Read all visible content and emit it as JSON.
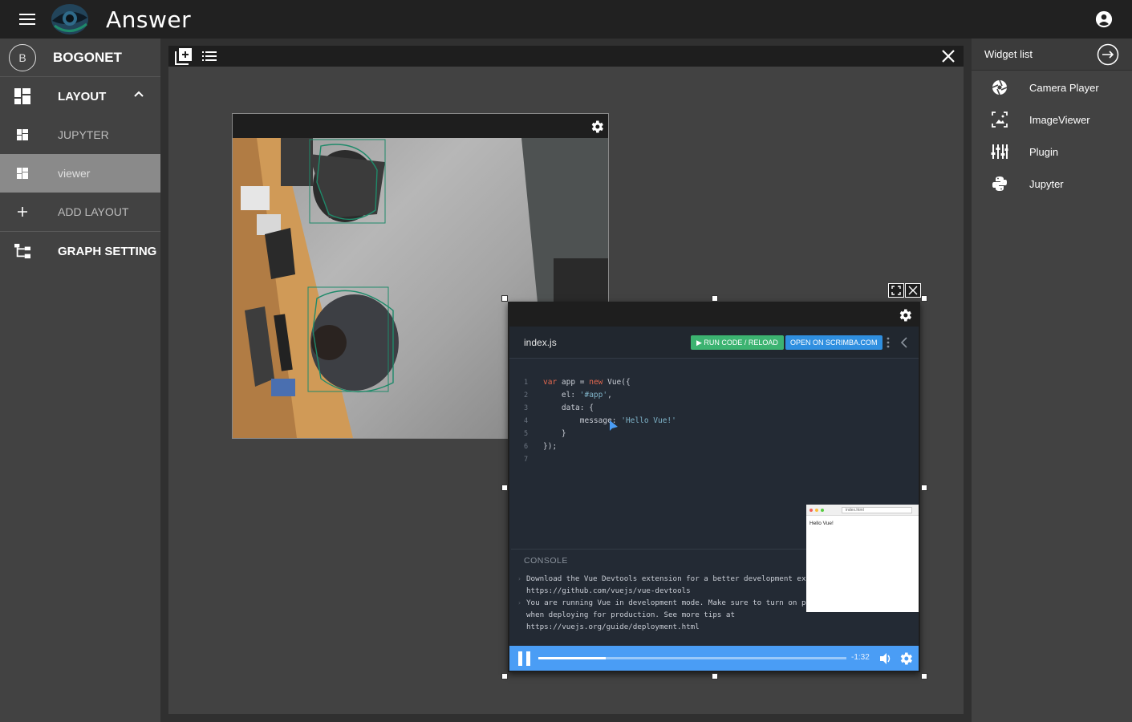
{
  "app": {
    "title": "Answer"
  },
  "sidebar": {
    "profile": {
      "initial": "B",
      "name": "BOGONET"
    },
    "items": [
      {
        "label": "LAYOUT",
        "icon": "dashboard-icon"
      },
      {
        "label": "JUPYTER",
        "icon": "dashboard-small-icon"
      },
      {
        "label": "viewer",
        "icon": "dashboard-small-icon"
      },
      {
        "label": "ADD LAYOUT",
        "icon": "plus-icon"
      },
      {
        "label": "GRAPH SETTING",
        "icon": "graph-tree-icon"
      }
    ]
  },
  "widget_list": {
    "title": "Widget list",
    "items": [
      {
        "label": "Camera Player",
        "icon": "aperture-icon"
      },
      {
        "label": "ImageViewer",
        "icon": "image-frame-icon"
      },
      {
        "label": "Plugin",
        "icon": "equalizer-icon"
      },
      {
        "label": "Jupyter",
        "icon": "python-icon"
      }
    ]
  },
  "plugin": {
    "filename": "index.js",
    "run_label": "▶ RUN CODE / RELOAD",
    "open_label": "OPEN ON SCRIMBA.COM",
    "code_lines": [
      {
        "n": "1",
        "text": "var app = new Vue({"
      },
      {
        "n": "2",
        "text": "    el: '#app',"
      },
      {
        "n": "3",
        "text": "    data: {"
      },
      {
        "n": "4",
        "text": "        message: 'Hello Vue!'"
      },
      {
        "n": "5",
        "text": "    }"
      },
      {
        "n": "6",
        "text": "});"
      },
      {
        "n": "7",
        "text": ""
      }
    ],
    "preview": {
      "url_text": "index.html",
      "content": "Hello Vue!"
    },
    "console_title": "CONSOLE",
    "console_lines": [
      {
        "text": "Download the Vue Devtools extension for a better development experience:"
      },
      {
        "text": "https://github.com/vuejs/vue-devtools",
        "cont": true
      },
      {
        "text": "You are running Vue in development mode. Make sure to turn on production mode"
      },
      {
        "text": "when deploying for production. See more tips at",
        "cont": true
      },
      {
        "text": "https://vuejs.org/guide/deployment.html",
        "cont": true
      }
    ],
    "player": {
      "time": "-1:32",
      "progress": 0.22
    }
  },
  "colors": {
    "run": "#3cb371",
    "open": "#2f8fe0",
    "playbar": "#4a9df5",
    "box": "#1f8a6a"
  }
}
